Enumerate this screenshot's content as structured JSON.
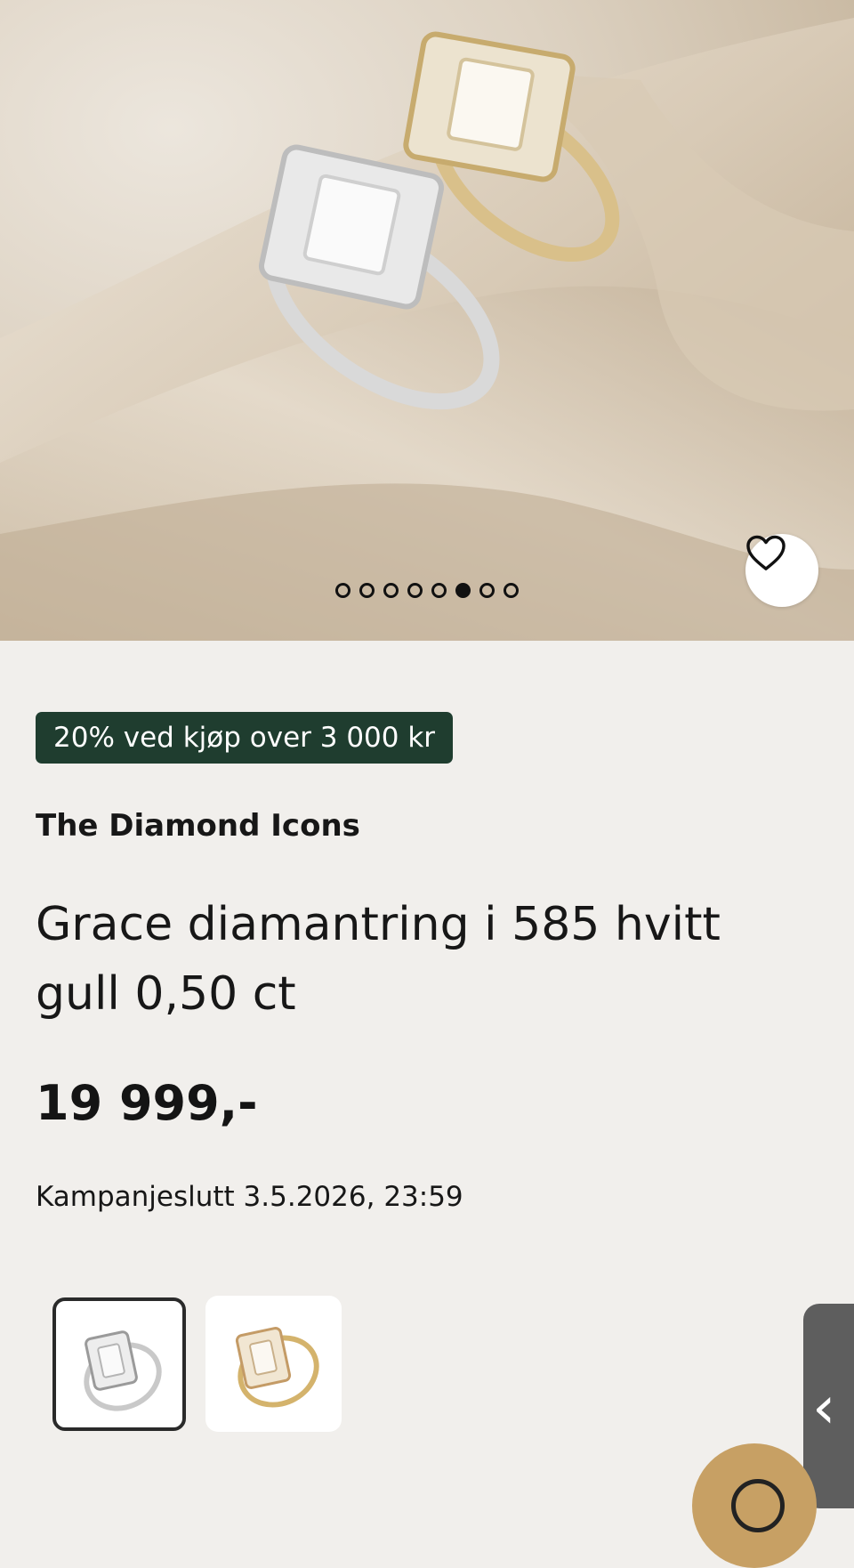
{
  "product": {
    "carousel": {
      "total_images": 8,
      "active_index": 5
    },
    "favorite_icon": "heart-outline-icon",
    "promo_badge": "20% ved kjøp over 3 000 kr",
    "brand": "The Diamond Icons",
    "title": "Grace diamantring i 585 hvitt gull 0,50 ct",
    "price": "19 999,-",
    "campaign_end": "Kampanjeslutt 3.5.2026, 23:59",
    "variants": [
      {
        "name": "white-gold-variant",
        "selected": true
      },
      {
        "name": "yellow-gold-variant",
        "selected": false
      }
    ]
  },
  "side_tab_icon": "chevron-left-icon",
  "colors": {
    "page_background": "#f1efec",
    "promo_badge": "#1f3d2f",
    "side_tab": "#5e5e5e",
    "gold_button": "#c7a064"
  }
}
